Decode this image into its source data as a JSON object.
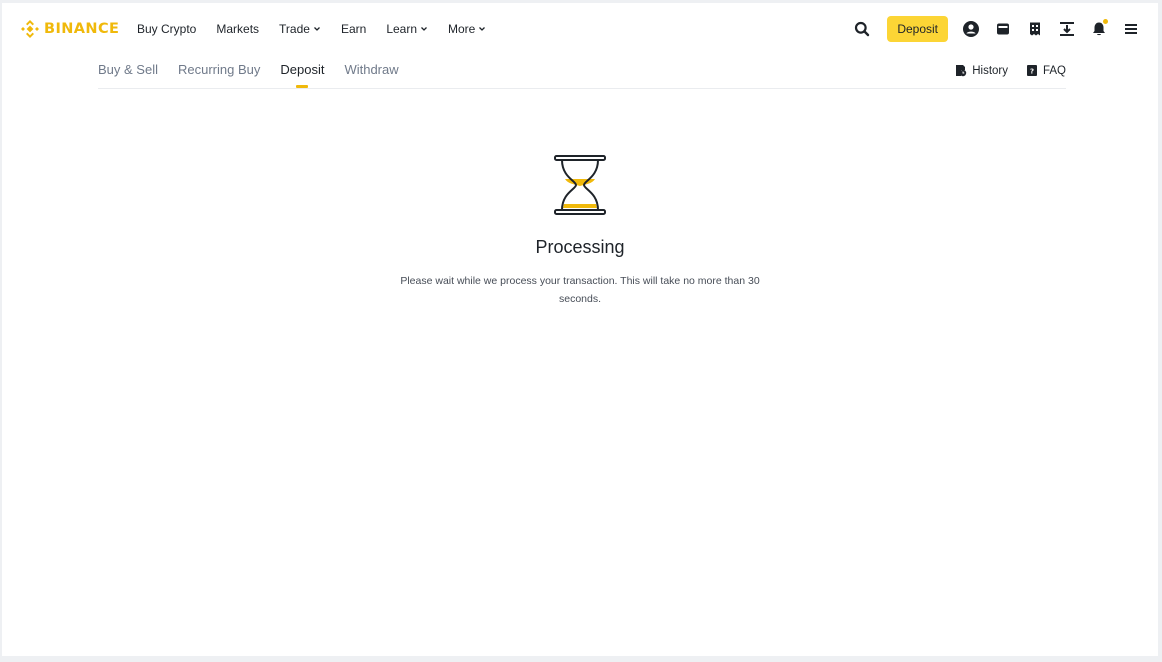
{
  "brand": {
    "name": "BINANCE",
    "color": "#f0b90b"
  },
  "nav": {
    "items": [
      {
        "label": "Buy Crypto",
        "dropdown": false
      },
      {
        "label": "Markets",
        "dropdown": false
      },
      {
        "label": "Trade",
        "dropdown": true
      },
      {
        "label": "Earn",
        "dropdown": false
      },
      {
        "label": "Learn",
        "dropdown": true
      },
      {
        "label": "More",
        "dropdown": true
      }
    ],
    "deposit_label": "Deposit",
    "icons": [
      "search-icon",
      "user-icon",
      "wallet-icon",
      "orders-icon",
      "download-icon",
      "bell-icon",
      "menu-icon"
    ]
  },
  "subnav": {
    "tabs": [
      {
        "label": "Buy & Sell",
        "active": false
      },
      {
        "label": "Recurring Buy",
        "active": false
      },
      {
        "label": "Deposit",
        "active": true
      },
      {
        "label": "Withdraw",
        "active": false
      }
    ],
    "history_label": "History",
    "faq_label": "FAQ"
  },
  "status": {
    "icon": "hourglass-icon",
    "title": "Processing",
    "message": "Please wait while we process your transaction. This will take no more than 30 seconds."
  },
  "colors": {
    "accent": "#fcd535",
    "brand": "#f0b90b",
    "text": "#1e2329",
    "muted": "#707a8a"
  }
}
